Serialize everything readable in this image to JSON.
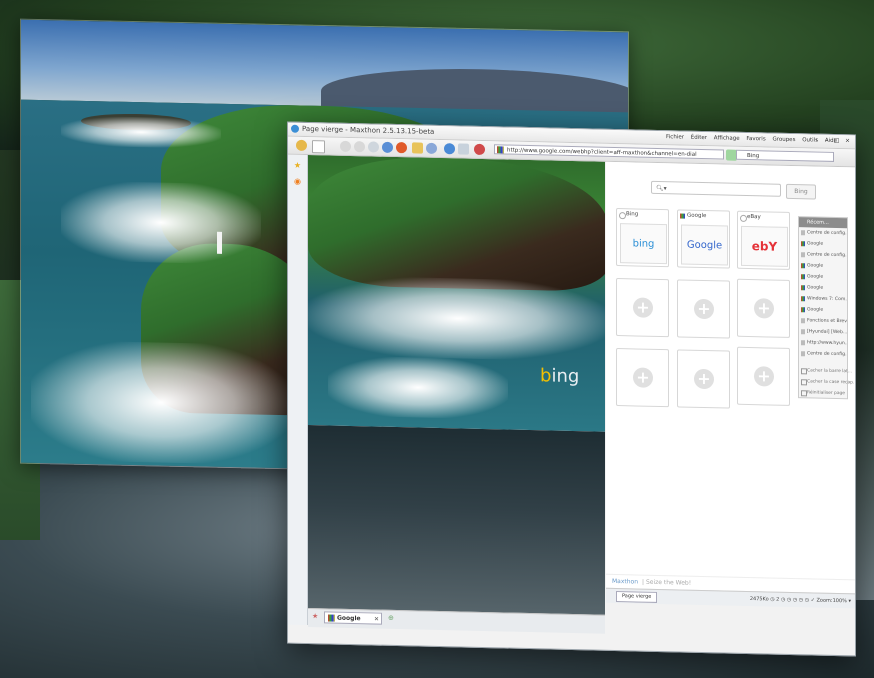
{
  "window": {
    "title": "Page vierge - Maxthon 2.5.13.15-beta",
    "menus": [
      "Fichier",
      "Éditer",
      "Affichage",
      "Favoris",
      "Groupes",
      "Outils",
      "Aide"
    ],
    "controls": [
      "‹",
      "–",
      "□",
      "×"
    ]
  },
  "toolbar": {
    "address": "http://www.google.com/webhp?client=aff-maxthon&channel=en-dial",
    "search_engine": "Bing",
    "search_value": "Bing"
  },
  "content": {
    "bing_watermark": "bing"
  },
  "speed_dial": {
    "search_placeholder": "",
    "search_button": "Bing",
    "tiles": [
      {
        "label": "Bing",
        "thumb": "bing"
      },
      {
        "label": "Google",
        "thumb": "Google"
      },
      {
        "label": "eBay",
        "thumb": "ebY"
      }
    ],
    "empty_tile_symbol": "+",
    "panel_title": "Récem...",
    "panel_items": [
      "Centre de config...",
      "Google",
      "Centre de config...",
      "Google",
      "Google",
      "Google",
      "Windows 7: Com...",
      "Google",
      "Fonctions et Brevi...",
      "[Hyundai] [Web...",
      "http://www.hyun...",
      "Centre de config..."
    ],
    "panel_options": [
      "Cacher la barre lat...",
      "Cacher la case recap.",
      "Réinitialiser page"
    ],
    "footer_brand": "Maxthon",
    "footer_tagline": "| Seize the Web!"
  },
  "status_bar": {
    "tab_label": "Page vierge",
    "right_text": "2475Ko ◷ 2 ◷ ◷ ◷ ◷ ◷ ✓ Zoom:100% ▾"
  },
  "tabs": {
    "active_tab": "Google",
    "close": "×"
  },
  "colors": {
    "accent": "#3b8fd6",
    "window_bg": "#f2f2f2",
    "status_bar": "#eceff2"
  },
  "icons": [
    "back-icon",
    "forward-icon",
    "stop-icon",
    "refresh-icon",
    "home-icon",
    "favorites-icon",
    "rss-icon",
    "star-icon"
  ]
}
